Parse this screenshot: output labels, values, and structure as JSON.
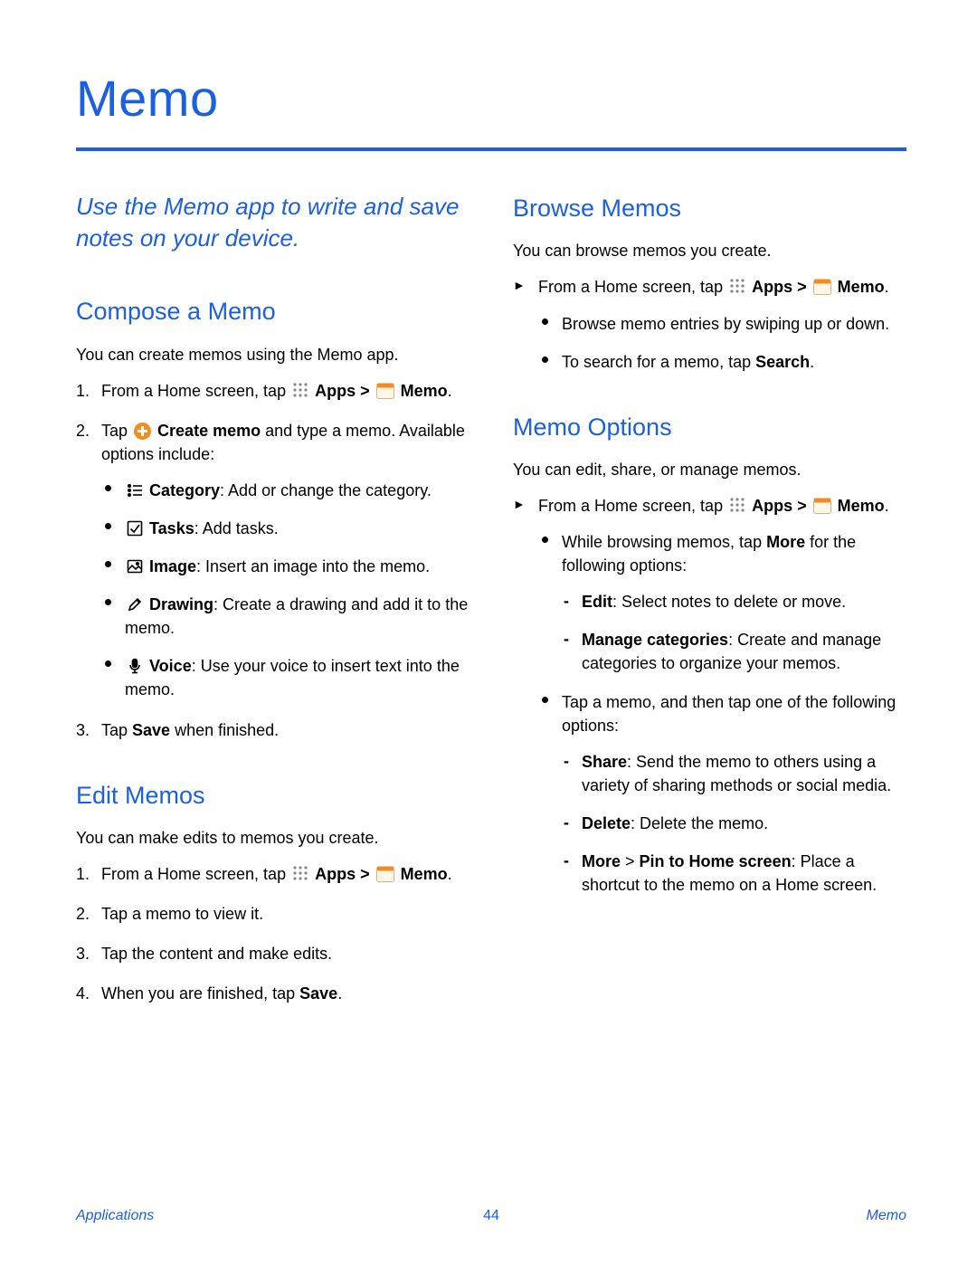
{
  "page": {
    "title": "Memo",
    "intro": "Use the Memo app to write and save notes on your device."
  },
  "common": {
    "apps_label": "Apps",
    "gt": " > ",
    "memo_label": "Memo",
    "period": "."
  },
  "compose": {
    "heading": "Compose a Memo",
    "lead": "You can create memos using the Memo app.",
    "s1_a": "From a Home screen, tap ",
    "s2_a": "Tap ",
    "s2_b": "Create memo",
    "s2_c": " and type a memo. Available options include:",
    "opts": {
      "category_b": "Category",
      "category_t": ": Add or change the category.",
      "tasks_b": "Tasks",
      "tasks_t": ": Add tasks.",
      "image_b": "Image",
      "image_t": ": Insert an image into the memo.",
      "drawing_b": "Drawing",
      "drawing_t": ": Create a drawing and add it to the memo.",
      "voice_b": "Voice",
      "voice_t": ": Use your voice to insert text into the memo."
    },
    "s3_a": "Tap ",
    "s3_b": "Save",
    "s3_c": " when finished."
  },
  "edit": {
    "heading": "Edit Memos",
    "lead": "You can make edits to memos you create.",
    "s1_a": "From a Home screen, tap ",
    "s2": "Tap a memo to view it.",
    "s3": "Tap the content and make edits.",
    "s4_a": "When you are finished, tap ",
    "s4_b": "Save",
    "s4_c": "."
  },
  "browse": {
    "heading": "Browse Memos",
    "lead": "You can browse memos you create.",
    "s1_a": "From a Home screen, tap ",
    "b1": "Browse memo entries by swiping up or down.",
    "b2_a": "To search for a memo, tap ",
    "b2_b": "Search",
    "b2_c": "."
  },
  "options": {
    "heading": "Memo Options",
    "lead": "You can edit, share, or manage memos.",
    "s1_a": "From a Home screen, tap ",
    "b1_a": "While browsing memos, tap ",
    "b1_b": "More",
    "b1_c": " for the following options:",
    "d1_b": "Edit",
    "d1_t": ": Select notes to delete or move.",
    "d2_b": "Manage categories",
    "d2_t": ": Create and manage categories to organize your memos.",
    "b2": "Tap a memo, and then tap one of the following options:",
    "d3_b": "Share",
    "d3_t": ": Send the memo to others using a variety of sharing methods or social media.",
    "d4_b": "Delete",
    "d4_t": ": Delete the memo.",
    "d5_b1": "More",
    "d5_gt": " > ",
    "d5_b2": "Pin to Home screen",
    "d5_t": ": Place a shortcut to the memo on a Home screen."
  },
  "footer": {
    "left": "Applications",
    "center": "44",
    "right": "Memo"
  }
}
